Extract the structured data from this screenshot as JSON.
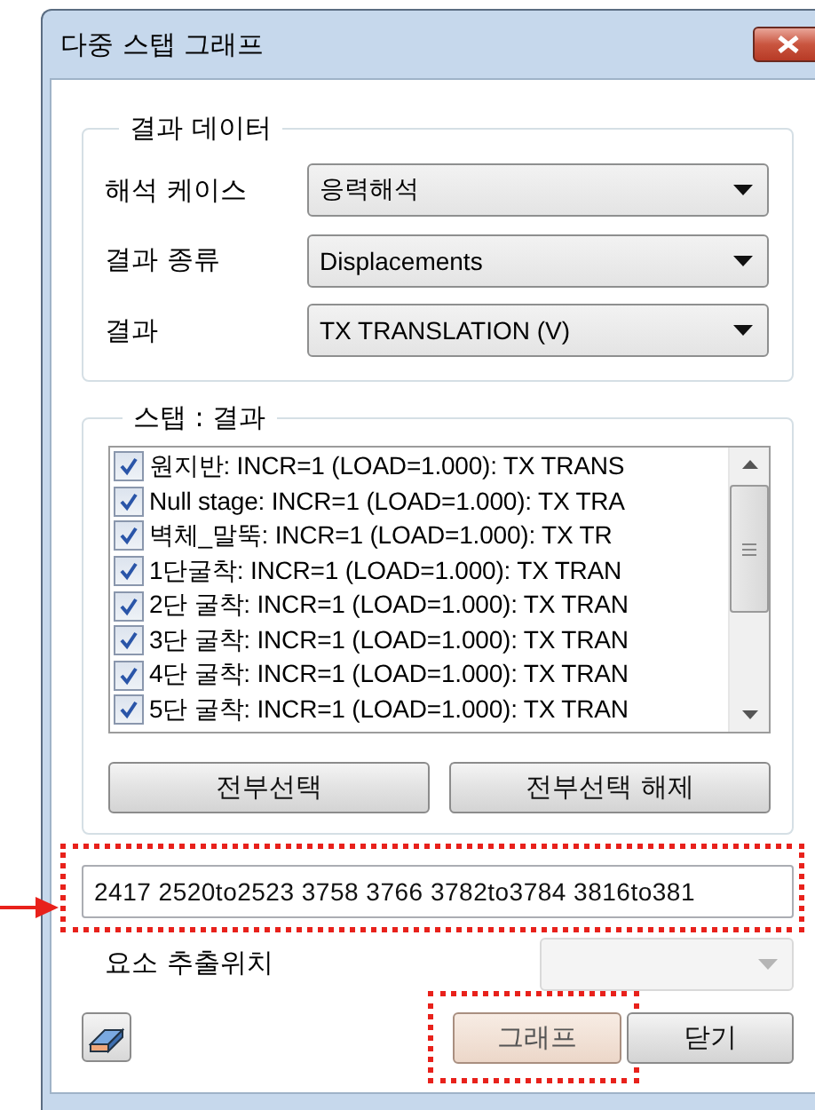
{
  "window": {
    "title": "다중 스탭 그래프"
  },
  "result_data": {
    "title": "결과 데이터",
    "fields": [
      {
        "label": "해석 케이스",
        "value": "응력해석"
      },
      {
        "label": "결과 종류",
        "value": "Displacements"
      },
      {
        "label": "결과",
        "value": "TX TRANSLATION (V)"
      }
    ]
  },
  "steps": {
    "title": "스탭 : 결과",
    "items": [
      {
        "label": "원지반: INCR=1 (LOAD=1.000): TX TRANS",
        "checked": true
      },
      {
        "label": "Null stage: INCR=1 (LOAD=1.000): TX TRA",
        "checked": true
      },
      {
        "label": "벽체_말뚝: INCR=1 (LOAD=1.000): TX TR",
        "checked": true
      },
      {
        "label": "1단굴착: INCR=1 (LOAD=1.000): TX TRAN",
        "checked": true
      },
      {
        "label": "2단 굴착: INCR=1 (LOAD=1.000): TX TRAN",
        "checked": true
      },
      {
        "label": "3단 굴착: INCR=1 (LOAD=1.000): TX TRAN",
        "checked": true
      },
      {
        "label": "4단 굴착: INCR=1 (LOAD=1.000): TX TRAN",
        "checked": true
      },
      {
        "label": "5단 굴착: INCR=1 (LOAD=1.000): TX TRAN",
        "checked": true
      }
    ],
    "buttons": [
      "전부선택",
      "전부선택 해제"
    ]
  },
  "element_ids": {
    "value": "2417 2520to2523 3758 3766 3782to3784 3816to381",
    "highlighted": true
  },
  "extract_position": {
    "label": "요소 추출위치",
    "disabled": true
  },
  "buttons": [
    {
      "label": "그래프",
      "highlighted": true
    },
    {
      "label": "닫기",
      "highlighted": false
    }
  ]
}
